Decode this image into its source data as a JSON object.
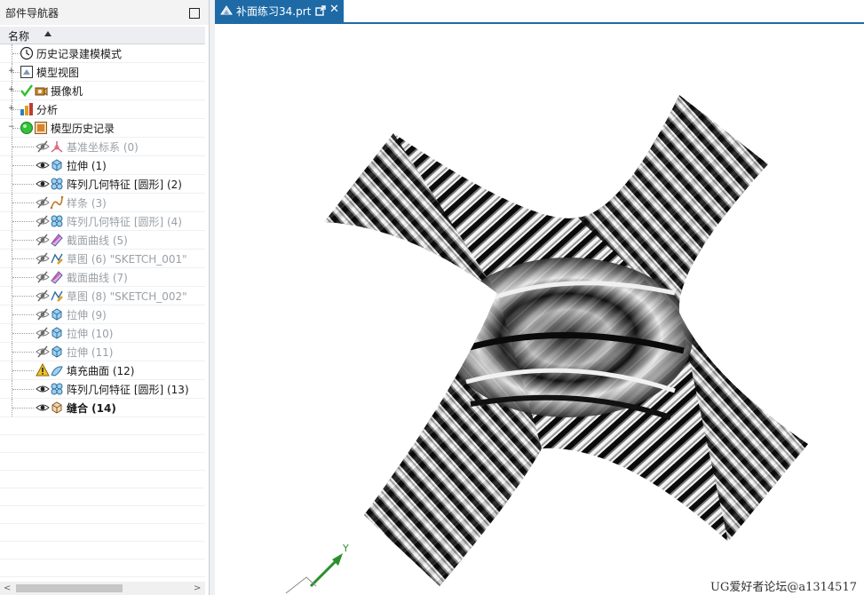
{
  "navigator": {
    "title": "部件导航器",
    "column_header": "名称",
    "items": [
      {
        "label": "历史记录建模模式",
        "icon": "clock-icon",
        "state": "normal"
      },
      {
        "label": "模型视图",
        "icon": "model-view-icon",
        "state": "normal",
        "expander": "+"
      },
      {
        "label": "摄像机",
        "icon": "camera-icon",
        "state": "normal",
        "expander": "+",
        "check": true
      },
      {
        "label": "分析",
        "icon": "analysis-icon",
        "state": "normal",
        "expander": "+"
      },
      {
        "label": "模型历史记录",
        "icon": "model-history-icon",
        "state": "normal",
        "expander": "−"
      },
      {
        "label": "基准坐标系 (0)",
        "icon": "datum-csys-icon",
        "state": "hidden"
      },
      {
        "label": "拉伸 (1)",
        "icon": "extrude-icon",
        "state": "visible"
      },
      {
        "label": "阵列几何特征 [圆形] (2)",
        "icon": "pattern-geometry-icon",
        "state": "visible"
      },
      {
        "label": "样条 (3)",
        "icon": "spline-icon",
        "state": "hidden"
      },
      {
        "label": "阵列几何特征 [圆形] (4)",
        "icon": "pattern-geometry-icon",
        "state": "hidden"
      },
      {
        "label": "截面曲线 (5)",
        "icon": "section-curve-icon",
        "state": "hidden"
      },
      {
        "label": "草图 (6) \"SKETCH_001\"",
        "icon": "sketch-icon",
        "state": "hidden"
      },
      {
        "label": "截面曲线 (7)",
        "icon": "section-curve-icon",
        "state": "hidden"
      },
      {
        "label": "草图 (8) \"SKETCH_002\"",
        "icon": "sketch-icon",
        "state": "hidden"
      },
      {
        "label": "拉伸 (9)",
        "icon": "extrude-icon",
        "state": "hidden"
      },
      {
        "label": "拉伸 (10)",
        "icon": "extrude-icon",
        "state": "hidden"
      },
      {
        "label": "拉伸 (11)",
        "icon": "extrude-icon",
        "state": "hidden"
      },
      {
        "label": "填充曲面 (12)",
        "icon": "fill-surface-icon",
        "state": "warning"
      },
      {
        "label": "阵列几何特征 [圆形] (13)",
        "icon": "pattern-geometry-icon",
        "state": "visible"
      },
      {
        "label": "缝合 (14)",
        "icon": "sew-icon",
        "state": "visible-bold"
      }
    ]
  },
  "tab": {
    "label": "补面练习34.prt"
  },
  "viewport": {
    "axis_label": "Y"
  },
  "watermark": "UG爱好者论坛@a1314517",
  "colors": {
    "accent": "#1e6aa6",
    "dim_text": "#9aa0a6",
    "check": "#2fbf2f"
  }
}
